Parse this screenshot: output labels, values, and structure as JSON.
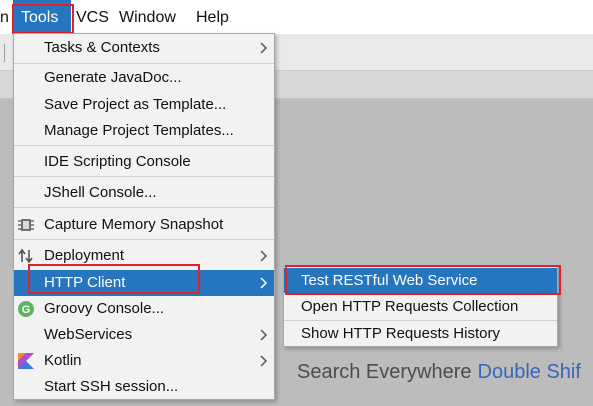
{
  "menubar": {
    "items": [
      {
        "id": "partial",
        "label": "n"
      },
      {
        "id": "tools",
        "label": "Tools"
      },
      {
        "id": "vcs",
        "label": "VCS"
      },
      {
        "id": "window",
        "label": "Window"
      },
      {
        "id": "help",
        "label": "Help"
      }
    ]
  },
  "tools_menu": {
    "items": [
      {
        "label": "Tasks & Contexts"
      },
      {
        "label": "Generate JavaDoc..."
      },
      {
        "label": "Save Project as Template..."
      },
      {
        "label": "Manage Project Templates..."
      },
      {
        "label": "IDE Scripting Console"
      },
      {
        "label": "JShell Console..."
      },
      {
        "label": "Capture Memory Snapshot"
      },
      {
        "label": "Deployment"
      },
      {
        "label": "HTTP Client"
      },
      {
        "label": "Groovy Console..."
      },
      {
        "label": "WebServices"
      },
      {
        "label": "Kotlin"
      },
      {
        "label": "Start SSH session..."
      }
    ],
    "groovy_icon_letter": "G"
  },
  "http_client_submenu": {
    "items": [
      {
        "label": "Test RESTful Web Service"
      },
      {
        "label": "Open HTTP Requests Collection"
      },
      {
        "label": "Show HTTP Requests History"
      }
    ]
  },
  "background_hint": {
    "text": "Search Everywhere",
    "shortcut": "Double Shif"
  },
  "colors": {
    "selection": "#2675bf",
    "highlight_box": "#e0202a",
    "menu_bg": "#f2f2f2",
    "shortcut_text": "#3767b8"
  }
}
